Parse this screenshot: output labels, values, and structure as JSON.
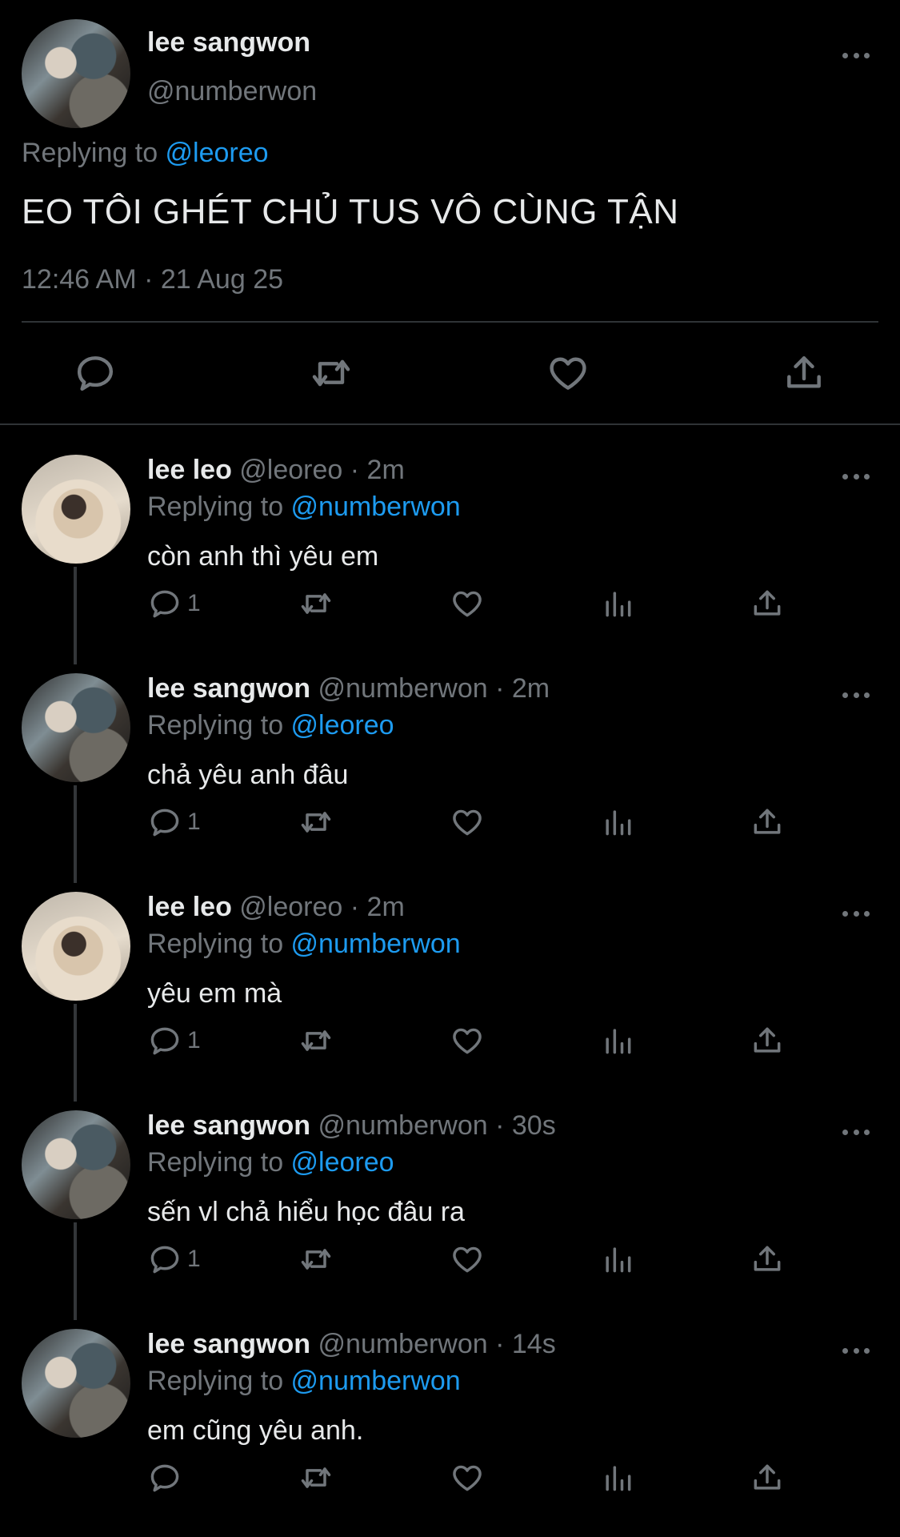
{
  "main_tweet": {
    "display_name": "lee sangwon",
    "handle": "@numberwon",
    "replying_prefix": "Replying to ",
    "replying_to": "@leoreo",
    "text": "EO TÔI GHÉT CHỦ TUS VÔ CÙNG TẬN",
    "timestamp": "12:46 AM · 21 Aug 25",
    "actions": [
      "reply-icon",
      "retweet-icon",
      "like-icon",
      "share-icon"
    ]
  },
  "replies": [
    {
      "display_name": "lee leo",
      "meta": "@leoreo · 2m",
      "replying_prefix": "Replying to ",
      "replying_to": "@numberwon",
      "text": "còn anh thì yêu em",
      "reply_count": "1",
      "avatar": "leo"
    },
    {
      "display_name": "lee sangwon",
      "meta": "@numberwon · 2m",
      "replying_prefix": "Replying to ",
      "replying_to": "@leoreo",
      "text": "chả yêu anh đâu",
      "reply_count": "1",
      "avatar": "sangwon"
    },
    {
      "display_name": "lee leo",
      "meta": "@leoreo · 2m",
      "replying_prefix": "Replying to ",
      "replying_to": "@numberwon",
      "text": "yêu em mà",
      "reply_count": "1",
      "avatar": "leo"
    },
    {
      "display_name": "lee sangwon",
      "meta": "@numberwon · 30s",
      "replying_prefix": "Replying to ",
      "replying_to": "@leoreo",
      "text": "sến vl chả hiểu học đâu ra",
      "reply_count": "1",
      "avatar": "sangwon"
    },
    {
      "display_name": "lee sangwon",
      "meta": "@numberwon · 14s",
      "replying_prefix": "Replying to ",
      "replying_to": "@numberwon",
      "text": "em cũng yêu anh.",
      "reply_count": "",
      "avatar": "sangwon"
    }
  ],
  "colors": {
    "background": "#000000",
    "text": "#e7e9ea",
    "muted": "#71767b",
    "link": "#1d9bf0",
    "divider": "#2f3336"
  }
}
